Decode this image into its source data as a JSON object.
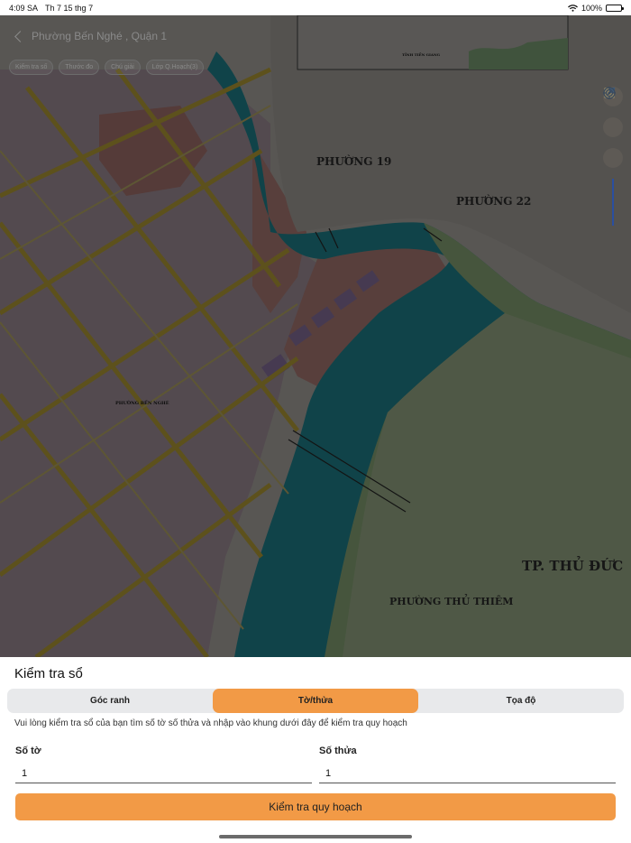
{
  "status_bar": {
    "time": "4:09 SA",
    "date": "Th 7 15 thg 7",
    "battery": "100%"
  },
  "map": {
    "header_title": "Phường Bến Nghé , Quận 1",
    "chips": [
      "Kiểm tra số",
      "Thước đo",
      "Chú giải",
      "Lớp Q.Hoạch(3)"
    ],
    "labels": {
      "phuong_19": "PHƯỜNG 19",
      "phuong_22": "PHƯỜNG 22",
      "tp_thu_duc": "TP. THỦ ĐỨC",
      "phuong_thu_thiem": "PHƯỜNG THỦ THIÊM",
      "phuong_ben_nghe": "PHƯỜNG BẾN NGHÉ",
      "tinh_tien_giang": "TỈNH TIỀN GIANG"
    },
    "tools": [
      "layers-icon",
      "compass-icon",
      "locate-icon"
    ]
  },
  "sheet": {
    "title": "Kiểm tra sổ",
    "tabs": [
      "Góc ranh",
      "Tờ/thửa",
      "Tọa độ"
    ],
    "active_tab": "Tờ/thửa",
    "hint": "Vui lòng kiểm tra sổ của bạn tìm số tờ số thửa và nhập vào khung dưới đây để kiểm tra quy hoạch",
    "so_to": {
      "label": "Số tờ",
      "value": "1"
    },
    "so_thua": {
      "label": "Số thửa",
      "value": "1"
    },
    "submit_label": "Kiểm tra quy hoạch"
  },
  "colors": {
    "accent": "#f29a46",
    "zoom_bar": "#2a4fa0"
  }
}
